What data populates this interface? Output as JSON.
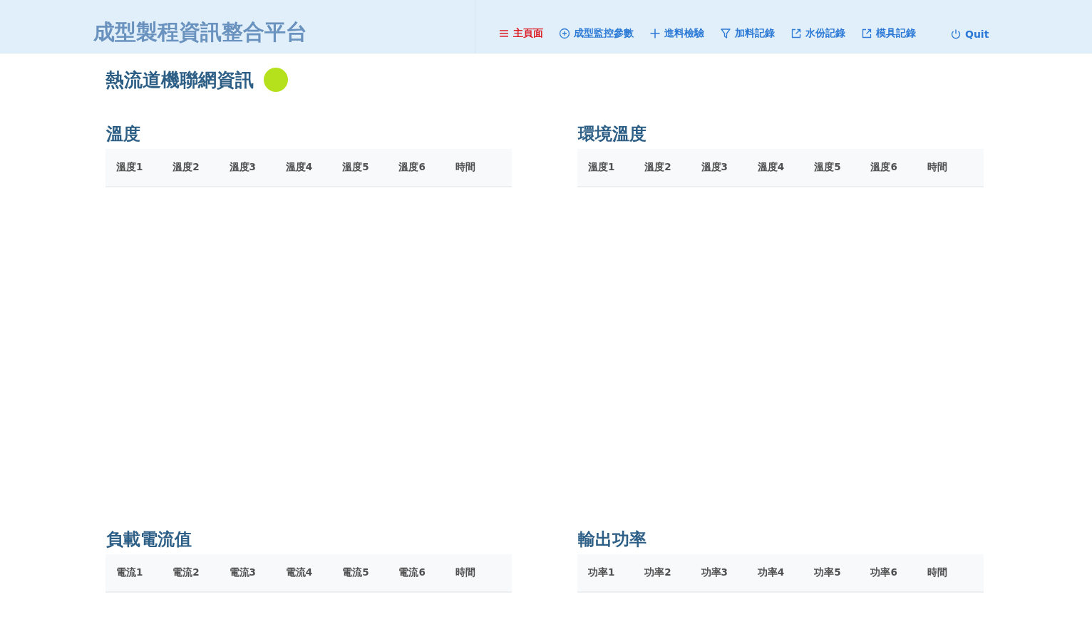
{
  "header": {
    "brand": "成型製程資訊整合平台",
    "nav": [
      {
        "label": "主頁面",
        "selected": true
      },
      {
        "label": "成型監控參數",
        "selected": false
      },
      {
        "label": "進料檢驗",
        "selected": false
      },
      {
        "label": "加料記錄",
        "selected": false
      },
      {
        "label": "水份記錄",
        "selected": false
      },
      {
        "label": "模具記錄",
        "selected": false
      },
      {
        "label": "Quit",
        "selected": false
      }
    ]
  },
  "page": {
    "title": "熱流道機聯網資訊",
    "status_dot": {
      "color": "#b5e01c"
    }
  },
  "sections": [
    {
      "title": "溫度",
      "table": {
        "columns": [
          "溫度1",
          "溫度2",
          "溫度3",
          "溫度4",
          "溫度5",
          "溫度6",
          "時間"
        ]
      }
    },
    {
      "title": "環境溫度",
      "table": {
        "columns": [
          "溫度1",
          "溫度2",
          "溫度3",
          "溫度4",
          "溫度5",
          "溫度6",
          "時間"
        ]
      }
    },
    {
      "title": "負載電流值",
      "table": {
        "columns": [
          "電流1",
          "電流2",
          "電流3",
          "電流4",
          "電流5",
          "電流6",
          "時間"
        ]
      }
    },
    {
      "title": "輸出功率",
      "table": {
        "columns": [
          "功率1",
          "功率2",
          "功率3",
          "功率4",
          "功率5",
          "功率6",
          "時間"
        ]
      }
    }
  ]
}
